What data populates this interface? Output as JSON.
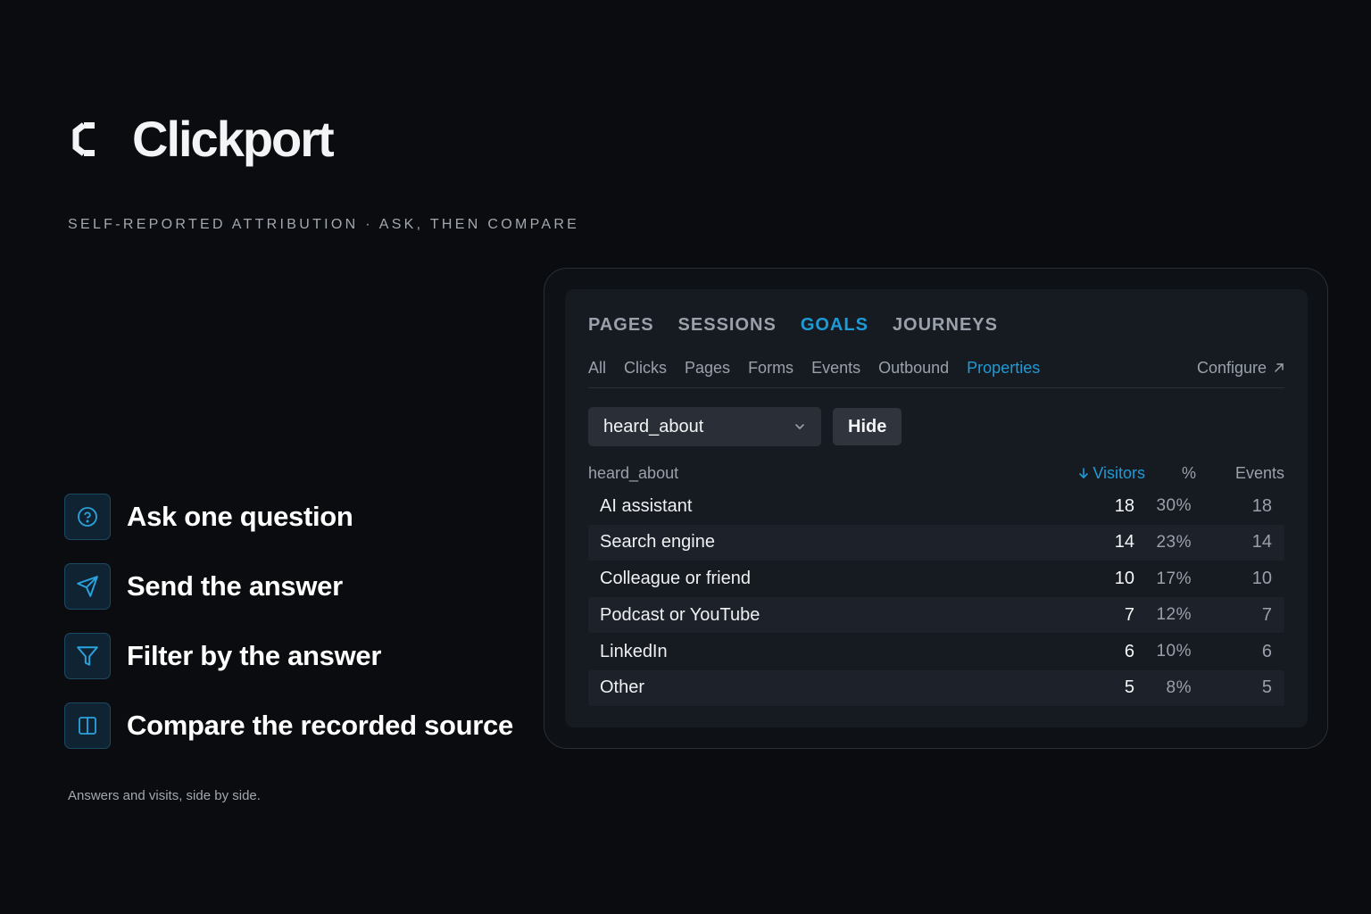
{
  "brand": {
    "name": "Clickport"
  },
  "tagline": "SELF-REPORTED ATTRIBUTION · ASK, THEN COMPARE",
  "steps": [
    {
      "icon": "question-circle-icon",
      "label": "Ask one question"
    },
    {
      "icon": "send-icon",
      "label": "Send the answer"
    },
    {
      "icon": "filter-icon",
      "label": "Filter by the answer"
    },
    {
      "icon": "split-panel-icon",
      "label": "Compare the recorded source"
    }
  ],
  "footnote": "Answers and visits, side by side.",
  "panel": {
    "main_tabs": [
      "PAGES",
      "SESSIONS",
      "GOALS",
      "JOURNEYS"
    ],
    "active_main_tab": "GOALS",
    "sub_tabs": [
      "All",
      "Clicks",
      "Pages",
      "Forms",
      "Events",
      "Outbound",
      "Properties"
    ],
    "active_sub_tab": "Properties",
    "configure_label": "Configure",
    "select_value": "heard_about",
    "hide_label": "Hide",
    "table": {
      "headers": {
        "name": "heard_about",
        "visitors": "Visitors",
        "pct": "%",
        "events": "Events"
      },
      "rows": [
        {
          "name": "AI assistant",
          "visitors": "18",
          "pct": "30%",
          "events": "18"
        },
        {
          "name": "Search engine",
          "visitors": "14",
          "pct": "23%",
          "events": "14"
        },
        {
          "name": "Colleague or friend",
          "visitors": "10",
          "pct": "17%",
          "events": "10"
        },
        {
          "name": "Podcast or YouTube",
          "visitors": "7",
          "pct": "12%",
          "events": "7"
        },
        {
          "name": "LinkedIn",
          "visitors": "6",
          "pct": "10%",
          "events": "6"
        },
        {
          "name": "Other",
          "visitors": "5",
          "pct": "8%",
          "events": "5"
        }
      ]
    }
  },
  "colors": {
    "accent": "#1e9bd7",
    "background": "#0a0c0f",
    "panel": "#161a21"
  }
}
